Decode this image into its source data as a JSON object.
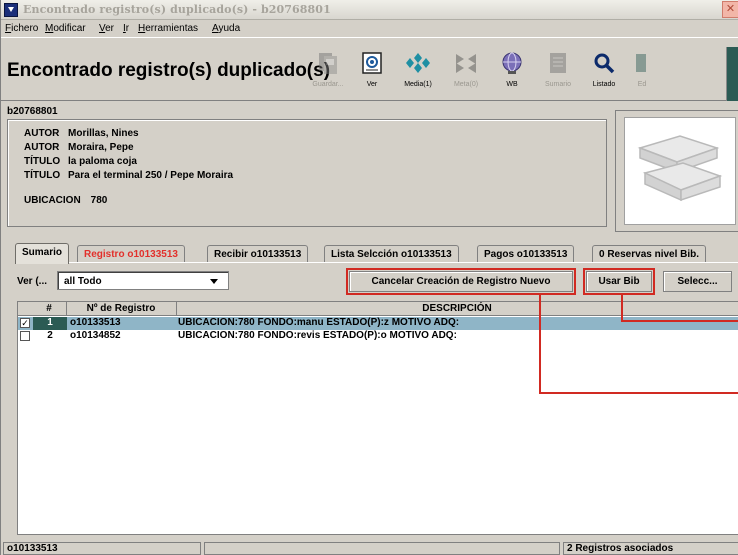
{
  "window": {
    "title": "Encontrado registro(s) duplicado(s) - b20768801",
    "close_glyph": "✕"
  },
  "menu": [
    "Fichero",
    "Modificar",
    "Ver",
    "Ir",
    "Herramientas",
    "Ayuda"
  ],
  "toolbar": {
    "heading": "Encontrado registro(s) duplicado(s)",
    "buttons": [
      {
        "label": "Guardar...",
        "icon": "save-icon",
        "enabled": false
      },
      {
        "label": "Ver",
        "icon": "view-icon",
        "enabled": true
      },
      {
        "label": "Media(1)",
        "icon": "media-icon",
        "enabled": true
      },
      {
        "label": "Meta(0)",
        "icon": "meta-icon",
        "enabled": false
      },
      {
        "label": "WB",
        "icon": "globe-icon",
        "enabled": true
      },
      {
        "label": "Sumario",
        "icon": "summary-icon",
        "enabled": false
      },
      {
        "label": "Listado",
        "icon": "magnifier-icon",
        "enabled": true
      },
      {
        "label": "Ed",
        "icon": "edit-icon",
        "enabled": false
      }
    ]
  },
  "record": {
    "id": "b20768801",
    "fields": [
      {
        "key": "AUTOR",
        "value": "Morillas, Nines"
      },
      {
        "key": "AUTOR",
        "value": "Moraira, Pepe"
      },
      {
        "key": "TÍTULO",
        "value": "la paloma coja"
      },
      {
        "key": "TÍTULO",
        "value": "Para el terminal 250 / Pepe Moraira"
      },
      {
        "key": "UBICACION",
        "value": "780"
      }
    ]
  },
  "tabs": [
    {
      "label": "Sumario",
      "active": true
    },
    {
      "label": "Registro o10133513",
      "active": false
    },
    {
      "label": "Recibir o10133513",
      "active": false
    },
    {
      "label": "Lista Selcción o10133513",
      "active": false
    },
    {
      "label": "Pagos o10133513",
      "active": false
    },
    {
      "label": "0 Reservas nivel Bib.",
      "active": false
    }
  ],
  "controls": {
    "ver_label": "Ver (...",
    "select_value": "all Todo",
    "cancel_button": "Cancelar Creación de Registro Nuevo",
    "use_bib_button": "Usar Bib",
    "select_button": "Selecc..."
  },
  "table": {
    "headers": [
      "#",
      "Nº de Registro",
      "DESCRIPCIÓN"
    ],
    "rows": [
      {
        "num": "1",
        "record": "o10133513",
        "desc": "UBICACION:780  FONDO:manu  ESTADO(P):z  MOTIVO  ADQ:",
        "selected": true,
        "checked": true
      },
      {
        "num": "2",
        "record": "o10134852",
        "desc": "UBICACION:780  FONDO:revis  ESTADO(P):o  MOTIVO  ADQ:",
        "selected": false,
        "checked": false
      }
    ]
  },
  "status": {
    "left": "o10133513",
    "middle": "",
    "right": "2 Registros asociados"
  },
  "colors": {
    "window_bg": "#d4d0c8",
    "selection": "#8fb5c7",
    "selection_index": "#2b5b54",
    "annotation_red": "#d12a22",
    "tab_red_text": "#e2302b"
  }
}
